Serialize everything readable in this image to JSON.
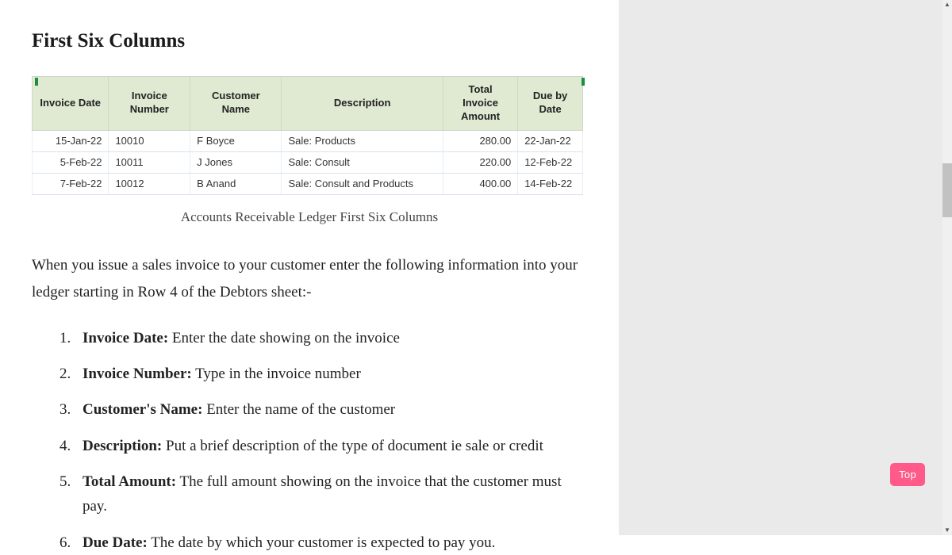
{
  "heading": "First Six Columns",
  "table": {
    "headers": [
      "Invoice Date",
      "Invoice Number",
      "Customer Name",
      "Description",
      "Total Invoice Amount",
      "Due by Date"
    ],
    "rows": [
      {
        "date": "15-Jan-22",
        "num": "10010",
        "name": "F Boyce",
        "desc": "Sale: Products",
        "amt": "280.00",
        "due": "22-Jan-22"
      },
      {
        "date": "5-Feb-22",
        "num": "10011",
        "name": "J Jones",
        "desc": "Sale: Consult",
        "amt": "220.00",
        "due": "12-Feb-22"
      },
      {
        "date": "7-Feb-22",
        "num": "10012",
        "name": "B Anand",
        "desc": "Sale: Consult and Products",
        "amt": "400.00",
        "due": "14-Feb-22"
      }
    ],
    "caption": "Accounts Receivable Ledger First Six Columns"
  },
  "intro_para": "When you issue a sales invoice to your customer enter the following information into your ledger starting in Row 4 of the Debtors sheet:-",
  "list": [
    {
      "term": "Invoice Date:",
      "def": " Enter the date showing on the invoice"
    },
    {
      "term": "Invoice Number:",
      "def": " Type in the invoice number"
    },
    {
      "term": "Customer's Name:",
      "def": " Enter the name of the customer"
    },
    {
      "term": "Description:",
      "def": " Put a brief description of the type of document ie sale or credit"
    },
    {
      "term": "Total Amount:",
      "def": " The full amount showing on the invoice that the customer must pay."
    },
    {
      "term": "Due Date:",
      "def": " The date by which your customer is expected to pay you."
    }
  ],
  "top_button": "Top"
}
